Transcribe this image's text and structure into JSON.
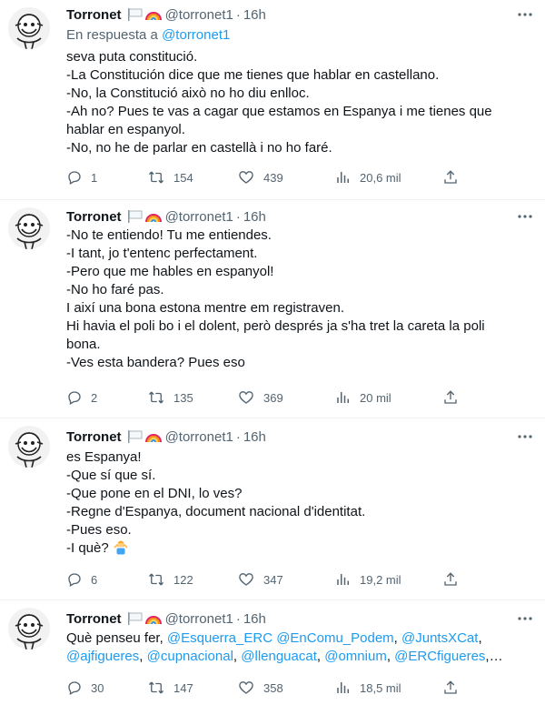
{
  "colors": {
    "text": "#0f1419",
    "secondary": "#536471",
    "link": "#1d9bf0",
    "divider": "#eff3f4"
  },
  "icons": [
    "reply-icon",
    "retweet-icon",
    "like-icon",
    "views-icon",
    "share-icon",
    "more-icon",
    "white-flag-icon",
    "rainbow-icon",
    "person-shrugging-emoji"
  ],
  "tweets": [
    {
      "name": "Torronet",
      "handle": "@torronet1",
      "dot": "·",
      "time": "16h",
      "reply_to_prefix": "En respuesta a",
      "reply_to_handle": "@torronet1",
      "lines": [
        "seva puta constitució.",
        "-La Constitución dice que me tienes que hablar en castellano.",
        "-No, la Constitució això no ho diu enlloc.",
        "-Ah no? Pues te vas a cagar que estamos en Espanya i me tienes que",
        "hablar en espanyol.",
        "-No, no he de parlar en castellà i no ho faré."
      ],
      "replies": "1",
      "retweets": "154",
      "likes": "439",
      "views": "20,6 mil"
    },
    {
      "name": "Torronet",
      "handle": "@torronet1",
      "dot": "·",
      "time": "16h",
      "lines": [
        "-No te entiendo! Tu me entiendes.",
        "-I tant, jo t'entenc perfectament.",
        "-Pero que me hables en espanyol!",
        "-No ho faré pas.",
        "I així una bona estona mentre em registraven.",
        "Hi havia el poli bo i el dolent, però després ja s'ha tret la careta la poli",
        "bona.",
        "-Ves esta bandera? Pues eso"
      ],
      "replies": "2",
      "retweets": "135",
      "likes": "369",
      "views": "20 mil"
    },
    {
      "name": "Torronet",
      "handle": "@torronet1",
      "dot": "·",
      "time": "16h",
      "lines": [
        "es Espanya!",
        "-Que sí que sí.",
        "-Que pone en el DNI, lo ves?",
        "-Regne d'Espanya, document nacional d'identitat.",
        "-Pues eso.",
        "-I què?"
      ],
      "replies": "6",
      "retweets": "122",
      "likes": "347",
      "views": "19,2 mil"
    },
    {
      "name": "Torronet",
      "handle": "@torronet1",
      "dot": "·",
      "time": "16h",
      "intro": "Què penseu fer,",
      "line1_mentions": [
        "@Esquerra_ERC",
        "@EnComu_Podem",
        "@JuntsXCat"
      ],
      "line2_mentions": [
        "@ajfigueres",
        "@cupnacional",
        "@llenguacat",
        "@omnium",
        "@ERCfigueres"
      ],
      "sep": ",",
      "ellipsis": "…",
      "replies": "30",
      "retweets": "147",
      "likes": "358",
      "views": "18,5 mil"
    }
  ]
}
